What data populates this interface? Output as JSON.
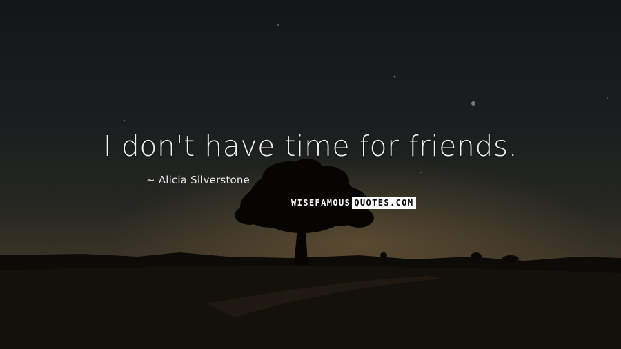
{
  "quote": {
    "text": "I don't have time for friends.",
    "author": "~ Alicia Silverstone"
  },
  "watermark": {
    "part_a": "WISEFAMOUS",
    "part_b": "QUOTES.COM"
  },
  "colors": {
    "text": "#f2f2f2",
    "watermark_bg": "#ffffff",
    "watermark_text": "#000000"
  }
}
